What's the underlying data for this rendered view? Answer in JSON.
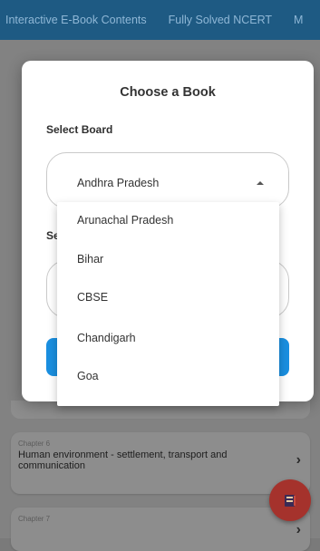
{
  "top_tabs": [
    "Interactive E-Book Contents",
    "Fully Solved NCERT",
    "M"
  ],
  "dialog": {
    "title": "Choose a Book",
    "board_label": "Select Board",
    "selected_board": "Andhra Pradesh",
    "second_label": "Se"
  },
  "dropdown_options": [
    "Arunachal Pradesh",
    "Bihar",
    "CBSE",
    "Chandigarh",
    "Goa"
  ],
  "chapters": [
    {
      "num": "Chapter 6",
      "title": "Human environment - settlement, transport and communication"
    },
    {
      "num": "Chapter 7",
      "title": ""
    }
  ],
  "colors": {
    "topbar": "#1e5a83",
    "accent_button": "#1a8fe0",
    "fab": "#a5322c"
  }
}
